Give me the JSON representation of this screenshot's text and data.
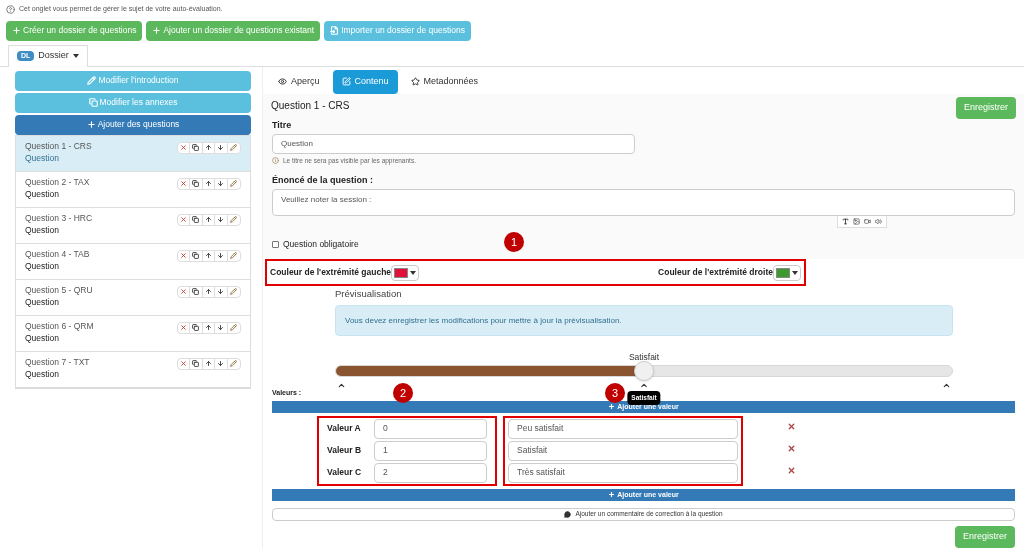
{
  "help_text": "Cet onglet vous permet de gérer le sujet de votre auto-évaluation.",
  "toolbar": [
    {
      "label": "Créer un dossier de questions",
      "kind": "create"
    },
    {
      "label": "Ajouter un dossier de questions existant",
      "kind": "add"
    },
    {
      "label": "Importer un dossier de questions",
      "kind": "import"
    }
  ],
  "folder_tab": {
    "badge": "DL",
    "label": "Dossier"
  },
  "sidebar": {
    "buttons": [
      {
        "label": "Modifier l'introduction",
        "kind": "edit"
      },
      {
        "label": "Modifier les annexes",
        "kind": "copy"
      },
      {
        "label": "Ajouter des questions",
        "kind": "add"
      }
    ],
    "items": [
      {
        "title": "Question 1 - CRS",
        "subtitle": "Question",
        "selected": true
      },
      {
        "title": "Question 2 - TAX",
        "subtitle": "Question",
        "selected": false
      },
      {
        "title": "Question 3 - HRC",
        "subtitle": "Question",
        "selected": false
      },
      {
        "title": "Question 4 - TAB",
        "subtitle": "Question",
        "selected": false
      },
      {
        "title": "Question 5 - QRU",
        "subtitle": "Question",
        "selected": false
      },
      {
        "title": "Question 6 - QRM",
        "subtitle": "Question",
        "selected": false
      },
      {
        "title": "Question 7 - TXT",
        "subtitle": "Question",
        "selected": false
      }
    ]
  },
  "tabs": [
    {
      "label": "Aperçu",
      "kind": "eye",
      "selected": false
    },
    {
      "label": "Contenu",
      "kind": "edit",
      "selected": true
    },
    {
      "label": "Metadonnées",
      "kind": "star",
      "selected": false
    }
  ],
  "editor": {
    "heading": "Question 1 - CRS",
    "save": "Enregistrer",
    "title_label": "Titre",
    "title_value": "Question",
    "title_hint": "Le titre ne sera pas visible par les apprenants.",
    "statement_label": "Énoncé de la question :",
    "statement_value": "Veuillez noter la session :",
    "required": {
      "label": "Question obligatoire",
      "checked": false
    },
    "left_color": {
      "label": "Couleur de l'extrémité gauche",
      "color": "#e0103a"
    },
    "right_color": {
      "label": "Couleur de l'extrémité droite",
      "color": "#3e9a2e"
    },
    "preview_label": "Prévisualisation",
    "preview_notice": "Vous devez enregistrer les modifications pour mettre à jour la prévisualisation.",
    "slider": {
      "value_label": "Satisfait",
      "level": 0.5,
      "tooltip": "Satisfait"
    },
    "values_label": "Valeurs :",
    "add_value": "Ajouter une valeur",
    "values": [
      {
        "label": "Valeur A",
        "value": "0",
        "text": "Peu satisfait"
      },
      {
        "label": "Valeur B",
        "value": "1",
        "text": "Satisfait"
      },
      {
        "label": "Valeur C",
        "value": "2",
        "text": "Très satisfait"
      }
    ],
    "add_value_bottom": "Ajouter une valeur",
    "comment": "Ajouter un commentaire de correction à la question",
    "save_bottom": "Enregistrer"
  },
  "annotations": [
    "1",
    "2",
    "3"
  ]
}
